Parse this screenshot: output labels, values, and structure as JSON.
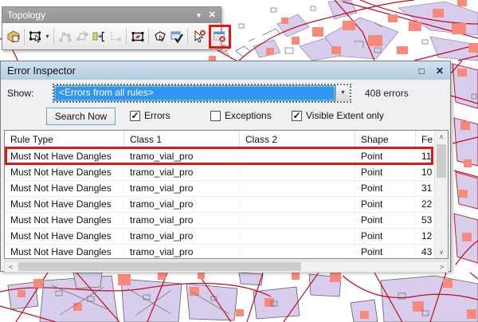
{
  "glyphs": {
    "dropdown_small": "▾",
    "close": "✕",
    "maximize": "□",
    "combo_arrow": "▼",
    "check": "✓",
    "scroll_up": "∧",
    "scroll_down": "∨",
    "scroll_left": "<",
    "scroll_right": ">"
  },
  "topology_toolbar": {
    "title": "Topology",
    "buttons": [
      {
        "icon": "map-topology-icon",
        "disabled": false
      },
      {
        "icon": "topology-edit-tool-icon",
        "disabled": false,
        "has_dropdown": true
      },
      {
        "icon": "construct-features-icon",
        "disabled": true
      },
      {
        "icon": "modify-edge-icon",
        "disabled": true
      },
      {
        "icon": "split-features-icon",
        "disabled": false
      },
      {
        "icon": "shared-features-icon",
        "disabled": true
      },
      {
        "icon": "validate-topology-in-specified-area-icon",
        "disabled": false
      },
      {
        "icon": "validate-topology-in-current-extent-icon",
        "disabled": false
      },
      {
        "icon": "validate-entire-topology-icon",
        "disabled": false
      },
      {
        "icon": "fix-topology-error-tool-icon",
        "disabled": false
      },
      {
        "icon": "error-inspector-icon",
        "disabled": false,
        "annotated": true
      }
    ]
  },
  "error_inspector": {
    "title": "Error Inspector",
    "show_label": "Show:",
    "show_value": "<Errors from all rules>",
    "error_count": "408 errors",
    "search_button_label": "Search Now",
    "checkboxes": [
      {
        "label": "Errors",
        "checked": true
      },
      {
        "label": "Exceptions",
        "checked": false
      },
      {
        "label": "Visible Extent only",
        "checked": true
      }
    ],
    "table": {
      "columns": [
        "Rule Type",
        "Class 1",
        "Class 2",
        "Shape",
        "Fe"
      ],
      "rows": [
        {
          "rule_type": "Must Not Have Dangles",
          "class_1": "tramo_vial_pro",
          "class_2": "",
          "shape": "Point",
          "fe": "11",
          "annotated": true
        },
        {
          "rule_type": "Must Not Have Dangles",
          "class_1": "tramo_vial_pro",
          "class_2": "",
          "shape": "Point",
          "fe": "10",
          "annotated": false
        },
        {
          "rule_type": "Must Not Have Dangles",
          "class_1": "tramo_vial_pro",
          "class_2": "",
          "shape": "Point",
          "fe": "31",
          "annotated": false
        },
        {
          "rule_type": "Must Not Have Dangles",
          "class_1": "tramo_vial_pro",
          "class_2": "",
          "shape": "Point",
          "fe": "22",
          "annotated": false
        },
        {
          "rule_type": "Must Not Have Dangles",
          "class_1": "tramo_vial_pro",
          "class_2": "",
          "shape": "Point",
          "fe": "53",
          "annotated": false
        },
        {
          "rule_type": "Must Not Have Dangles",
          "class_1": "tramo_vial_pro",
          "class_2": "",
          "shape": "Point",
          "fe": "12",
          "annotated": false
        },
        {
          "rule_type": "Must Not Have Dangles",
          "class_1": "tramo_vial_pro",
          "class_2": "",
          "shape": "Point",
          "fe": "43",
          "annotated": false
        }
      ]
    }
  },
  "colors": {
    "annotation_red": "#e31616",
    "selection_blue": "#2f96f3",
    "inspector_titlebar_blue": "#bdd6ea",
    "toolbar_titlebar_gray": "#9b9b9b",
    "map_parcel_lavender": "#d8cdec",
    "map_building_salmon": "#f9897b",
    "map_road_red": "#bf0b20"
  }
}
